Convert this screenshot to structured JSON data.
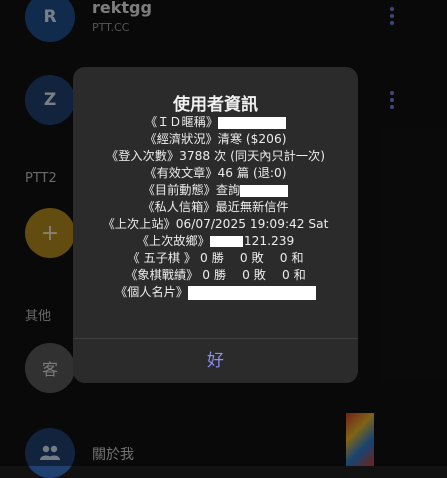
{
  "list": {
    "items": [
      {
        "initial": "R",
        "title": "rektgg",
        "subtitle": "PTT.CC"
      },
      {
        "initial": "Z"
      }
    ],
    "section_ptt2": "PTT2",
    "add_symbol": "+",
    "section_other": "其他",
    "guest_initial": "客",
    "about_label": "關於我"
  },
  "dialog": {
    "title": "使用者資訊",
    "lines": {
      "id": "《ＩＤ暱稱》",
      "economy": "《經濟狀況》清寒 ($206)",
      "logins": "《登入次數》3788 次 (同天內只計一次)",
      "posts": "《有效文章》46 篇 (退:0)",
      "activity": "《目前動態》查詢",
      "mail": "《私人信箱》最近無新信件",
      "last_login": "《上次上站》06/07/2025 19:09:42 Sat",
      "last_host_label": "《上次故鄉》",
      "last_host_value": "121.239",
      "gomoku": "《 五子棋 》 0 勝　 0 敗　 0 和",
      "chess": "《象棋戰績》 0 勝　 0 敗　 0 和",
      "card": "《個人名片》"
    },
    "ok_label": "好"
  },
  "colors": {
    "accent": "#8e8cf0",
    "dialog_bg": "#2b2b2b",
    "avatar_blue": "#1f4f8c",
    "avatar_gold": "#b58b1e"
  }
}
